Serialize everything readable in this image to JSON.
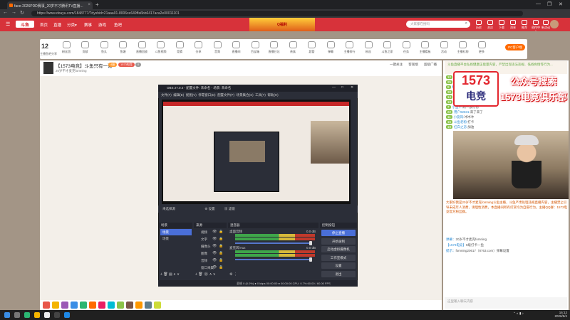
{
  "browser": {
    "tab_title": "face-2026PDD赛事_20岁不才腾讯TV直播...",
    "url": "https://www.douyu.com/1848777/?dyshid=21aaa01-8006ce649ffa6bb6417aca2e00011101",
    "controls": [
      "←",
      "→",
      "↻"
    ],
    "window_controls": [
      "—",
      "❐",
      "✕"
    ]
  },
  "douyu_header": {
    "logo": "斗鱼",
    "nav": [
      "首页",
      "直播",
      "分类▾",
      "赛事",
      "游戏",
      "鱼吧"
    ],
    "banner": "Q福利",
    "search_placeholder": "大家都在搜吗",
    "icons": [
      "历史",
      "关注",
      "下载",
      "消息",
      "推荐",
      "创作中心",
      "新活动"
    ]
  },
  "toolbar": {
    "level": "12",
    "level_label": "主播鱼吧分享",
    "items": [
      "粉丝团",
      "贡献",
      "鱼丸",
      "鱼塘",
      "直播回放",
      "斗鱼视频",
      "竞猜",
      "分享",
      "音频",
      "直播间",
      "百宝箱",
      "直播日记",
      "贵族",
      "超管",
      "弹幕",
      "主播排行",
      "粉丝",
      "斗鱼之家",
      "任务",
      "主播看板",
      "活动",
      "主播礼物",
      "更多"
    ],
    "pc_button": "PC客户端"
  },
  "room": {
    "title": "【1573电竞】斗鱼只有一哥",
    "subtitle": "20岁不才麦克fomning",
    "tags": [
      "4级",
      "1573电竞",
      "0"
    ],
    "buttons": [
      "一键关注",
      "客观端",
      "超级广播"
    ]
  },
  "obs": {
    "title": "OBS 27.0.4 - 配置文件: 未命名 - 场景: 未命名",
    "menu": [
      "文件(F)",
      "编辑(E)",
      "视图(V)",
      "停靠窗口(D)",
      "配置文件(P)",
      "场景集合(S)",
      "工具(T)",
      "帮助(H)"
    ],
    "source_bar": [
      "未选择源",
      "⚙ 设置",
      "▦ 滤镜"
    ],
    "scenes_header": "场景",
    "scenes": [
      "场景",
      "场景"
    ],
    "sources_header": "来源",
    "sources": [
      "视频",
      "文字",
      "摄像头",
      "图像",
      "音频",
      "窗口采集"
    ],
    "mixer_header": "混音器",
    "mixer": [
      {
        "name": "桌面音频",
        "db": "0.0 dB"
      },
      {
        "name": "麦克风/Aux",
        "db": "0.0 dB"
      }
    ],
    "transitions_header": "场景转场",
    "controls_header": "控制按钮",
    "controls": [
      "停止直播",
      "开始录制",
      "启动虚拟摄像机",
      "工作室模式",
      "设置",
      "退出"
    ],
    "status": "丢帧 0 (0.0%)     ●  0 kbps    00:00:00    ●  00:00:00    CPU: 0.7%  60.00 / 60.00 FPS"
  },
  "sidebar": {
    "notice": "斗鱼直播平台弘扬健康正能量内容，严禁出现违法违规、低俗色情等行为...",
    "chat": [
      {
        "lv": "12",
        "user": "用户11124:",
        "text": "欢迎来到直播间"
      },
      {
        "lv": "25",
        "user": "20岁不才:",
        "text": "1573电竞 最强"
      },
      {
        "lv": "9",
        "user": "暖心小伙:",
        "text": "我来了"
      },
      {
        "lv": "30",
        "user": "老铁666:",
        "text": "主播好帅"
      },
      {
        "lv": "14",
        "user": "摸鱼达人:",
        "text": "什么时候开打"
      },
      {
        "lv": "18",
        "user": "快乐星球:",
        "text": "牛啊"
      },
      {
        "lv": "7",
        "user": "小鱼干:",
        "text": "刷一波礼物"
      },
      {
        "lv": "22",
        "user": "用户92831:",
        "text": "来了来了"
      },
      {
        "lv": "11",
        "user": "小旋风:",
        "text": "冲冲冲"
      },
      {
        "lv": "16",
        "user": "斗鱼老粉:",
        "text": "打卡"
      },
      {
        "lv": "19",
        "user": "红白之恋:",
        "text": "加油"
      }
    ],
    "overlay_logo_top": "1573",
    "overlay_logo_bottom": "电竞",
    "overlay_text": [
      "公众号搜索",
      "1573电竞俱乐部"
    ],
    "description": "大家好我是20岁不才麦克fomning斗鱼主播，斗鱼严肃处理违规直播内容，主播禁止引导未成年人消费，请理性消费，本直播间所有打赏均为自愿行为。主播QQ群：1573电竞官方粉丝群。",
    "chat_bottom": [
      {
        "user": "弹幕：",
        "text": "20岁不才麦克fomning"
      },
      {
        "user": "【1573电竞】",
        "text": "5级打卡一鱼"
      },
      {
        "user": "提示：",
        "text": "fomning20617（8763.com）弹幕设置"
      }
    ],
    "input_placeholder": "这里输入聊天内容"
  },
  "taskbar": {
    "time": "16:12",
    "date": "2026/5/4"
  }
}
